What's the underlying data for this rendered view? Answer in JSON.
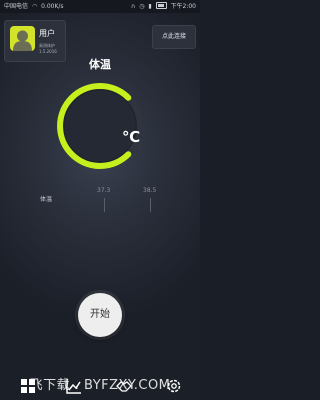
{
  "status_bar": {
    "carrier": "中国电信",
    "speed": "0.00K/s",
    "time": "下午2:00"
  },
  "user": {
    "name": "用户",
    "version_lines": [
      "易测体护",
      "1.5.2016"
    ]
  },
  "connect_button": "点此连接",
  "title": "体温",
  "gauge": {
    "unit": "℃",
    "color": "#c6f01d",
    "ring_color": "#2f343f"
  },
  "reading": {
    "label": "体温",
    "marks": [
      "37.3",
      "38.5"
    ]
  },
  "start_button": "开始",
  "bottom_nav": [
    "home-icon",
    "chart-icon",
    "handshake-icon",
    "settings-icon"
  ],
  "watermark": "飞下载 . BYFZXY.COM"
}
